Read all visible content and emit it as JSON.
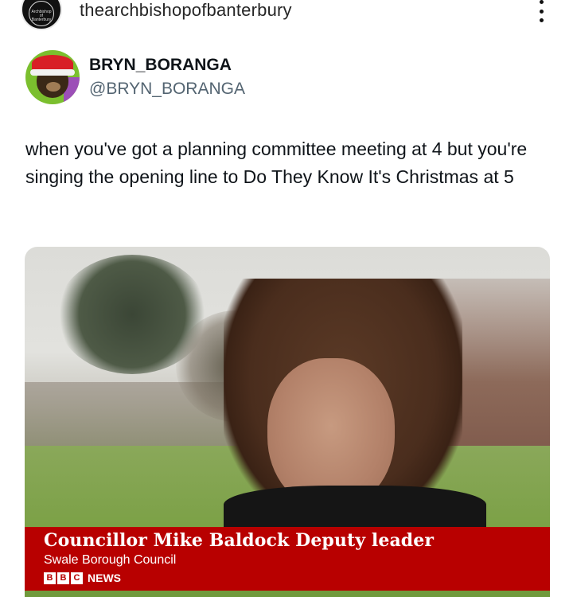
{
  "post": {
    "username": "thearchbishopofbanterbury",
    "avatar_text": "Archbishop of Banterbury"
  },
  "tweet": {
    "display_name": "BRYN_BORANGA",
    "handle": "@BRYN_BORANGA",
    "text": "when you've got a planning committee meeting at 4 but you're singing the opening line to Do They Know It's Christmas at 5"
  },
  "media": {
    "caption_title": "Councillor Mike Baldock Deputy leader",
    "caption_subtitle": "Swale Borough Council",
    "logo_letters": [
      "B",
      "B",
      "C"
    ],
    "logo_suffix": "NEWS",
    "caption_color": "#b80000"
  },
  "icons": {
    "more": "more-vertical-icon"
  }
}
